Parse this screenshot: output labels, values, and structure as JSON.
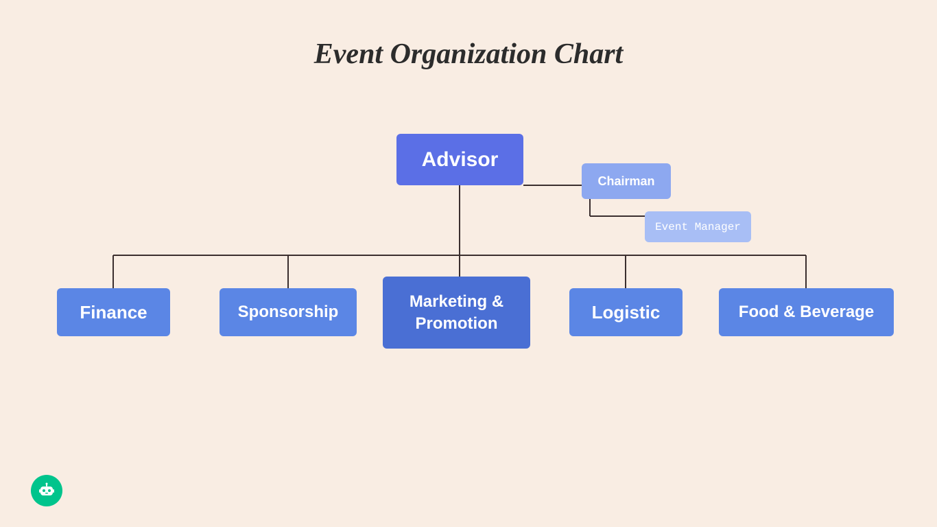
{
  "title": "Event Organization Chart",
  "nodes": {
    "advisor": {
      "label": "Advisor"
    },
    "chairman": {
      "label": "Chairman"
    },
    "event_manager": {
      "label": "Event Manager"
    },
    "finance": {
      "label": "Finance"
    },
    "sponsorship": {
      "label": "Sponsorship"
    },
    "marketing": {
      "label": "Marketing &\nPromotion"
    },
    "logistic": {
      "label": "Logistic"
    },
    "food": {
      "label": "Food & Beverage"
    }
  },
  "colors": {
    "background": "#f9ede3",
    "advisor": "#5b6fe6",
    "chairman": "#8da8f0",
    "event_manager": "#a8bef5",
    "blue": "#5b86e5",
    "dark_blue": "#4a6fd4",
    "connector": "#3a2e2e",
    "bot": "#00c48c"
  }
}
